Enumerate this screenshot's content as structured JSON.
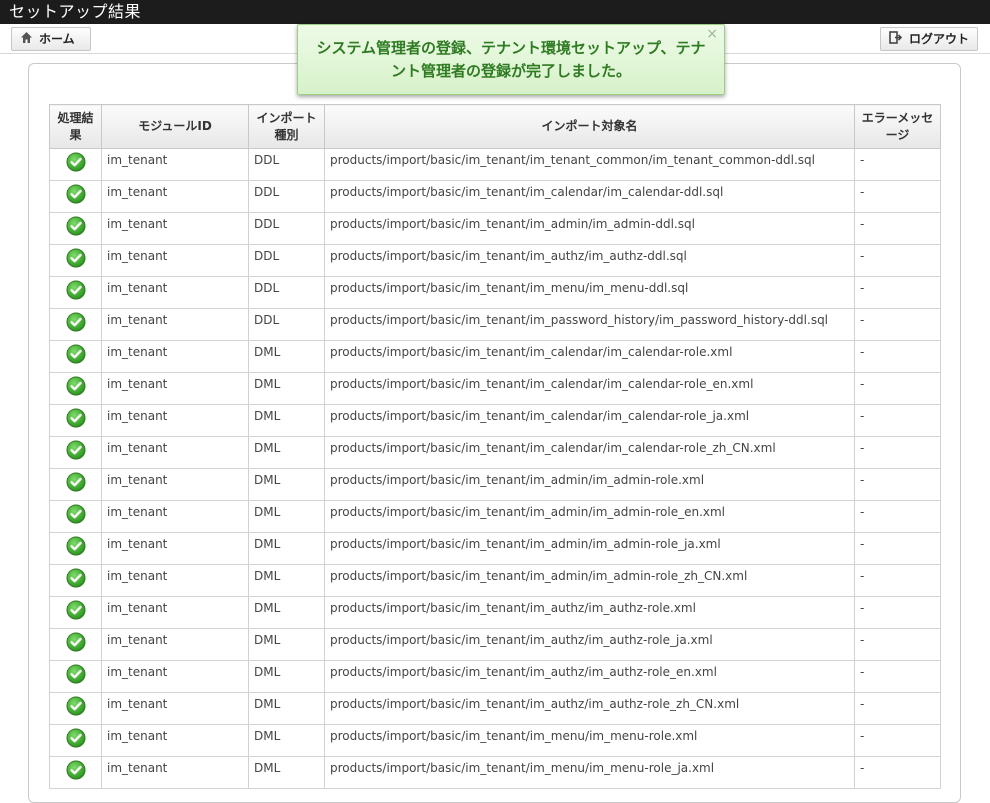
{
  "window": {
    "title": "セットアップ結果"
  },
  "toolbar": {
    "home_label": "ホーム",
    "logout_label": "ログアウト"
  },
  "notice": {
    "message": "システム管理者の登録、テナント環境セットアップ、テナント管理者の登録が完了しました。",
    "close": "×"
  },
  "table": {
    "headers": [
      "処理結果",
      "モジュールID",
      "インポート種別",
      "インポート対象名",
      "エラーメッセージ"
    ],
    "rows": [
      {
        "status": "success",
        "module": "im_tenant",
        "type": "DDL",
        "target": "products/import/basic/im_tenant/im_tenant_common/im_tenant_common-ddl.sql",
        "error": "-"
      },
      {
        "status": "success",
        "module": "im_tenant",
        "type": "DDL",
        "target": "products/import/basic/im_tenant/im_calendar/im_calendar-ddl.sql",
        "error": "-"
      },
      {
        "status": "success",
        "module": "im_tenant",
        "type": "DDL",
        "target": "products/import/basic/im_tenant/im_admin/im_admin-ddl.sql",
        "error": "-"
      },
      {
        "status": "success",
        "module": "im_tenant",
        "type": "DDL",
        "target": "products/import/basic/im_tenant/im_authz/im_authz-ddl.sql",
        "error": "-"
      },
      {
        "status": "success",
        "module": "im_tenant",
        "type": "DDL",
        "target": "products/import/basic/im_tenant/im_menu/im_menu-ddl.sql",
        "error": "-"
      },
      {
        "status": "success",
        "module": "im_tenant",
        "type": "DDL",
        "target": "products/import/basic/im_tenant/im_password_history/im_password_history-ddl.sql",
        "error": "-"
      },
      {
        "status": "success",
        "module": "im_tenant",
        "type": "DML",
        "target": "products/import/basic/im_tenant/im_calendar/im_calendar-role.xml",
        "error": "-"
      },
      {
        "status": "success",
        "module": "im_tenant",
        "type": "DML",
        "target": "products/import/basic/im_tenant/im_calendar/im_calendar-role_en.xml",
        "error": "-"
      },
      {
        "status": "success",
        "module": "im_tenant",
        "type": "DML",
        "target": "products/import/basic/im_tenant/im_calendar/im_calendar-role_ja.xml",
        "error": "-"
      },
      {
        "status": "success",
        "module": "im_tenant",
        "type": "DML",
        "target": "products/import/basic/im_tenant/im_calendar/im_calendar-role_zh_CN.xml",
        "error": "-"
      },
      {
        "status": "success",
        "module": "im_tenant",
        "type": "DML",
        "target": "products/import/basic/im_tenant/im_admin/im_admin-role.xml",
        "error": "-"
      },
      {
        "status": "success",
        "module": "im_tenant",
        "type": "DML",
        "target": "products/import/basic/im_tenant/im_admin/im_admin-role_en.xml",
        "error": "-"
      },
      {
        "status": "success",
        "module": "im_tenant",
        "type": "DML",
        "target": "products/import/basic/im_tenant/im_admin/im_admin-role_ja.xml",
        "error": "-"
      },
      {
        "status": "success",
        "module": "im_tenant",
        "type": "DML",
        "target": "products/import/basic/im_tenant/im_admin/im_admin-role_zh_CN.xml",
        "error": "-"
      },
      {
        "status": "success",
        "module": "im_tenant",
        "type": "DML",
        "target": "products/import/basic/im_tenant/im_authz/im_authz-role.xml",
        "error": "-"
      },
      {
        "status": "success",
        "module": "im_tenant",
        "type": "DML",
        "target": "products/import/basic/im_tenant/im_authz/im_authz-role_ja.xml",
        "error": "-"
      },
      {
        "status": "success",
        "module": "im_tenant",
        "type": "DML",
        "target": "products/import/basic/im_tenant/im_authz/im_authz-role_en.xml",
        "error": "-"
      },
      {
        "status": "success",
        "module": "im_tenant",
        "type": "DML",
        "target": "products/import/basic/im_tenant/im_authz/im_authz-role_zh_CN.xml",
        "error": "-"
      },
      {
        "status": "success",
        "module": "im_tenant",
        "type": "DML",
        "target": "products/import/basic/im_tenant/im_menu/im_menu-role.xml",
        "error": "-"
      },
      {
        "status": "success",
        "module": "im_tenant",
        "type": "DML",
        "target": "products/import/basic/im_tenant/im_menu/im_menu-role_ja.xml",
        "error": "-"
      }
    ]
  },
  "icons": {
    "home": "home-icon",
    "logout": "logout-icon",
    "status_ok": "check-circle-icon"
  },
  "colors": {
    "titlebar": "#1c1c1c",
    "notice_text": "#2f7b22",
    "notice_bg": "#e2f5d8",
    "ok_green": "#3aa12a"
  }
}
